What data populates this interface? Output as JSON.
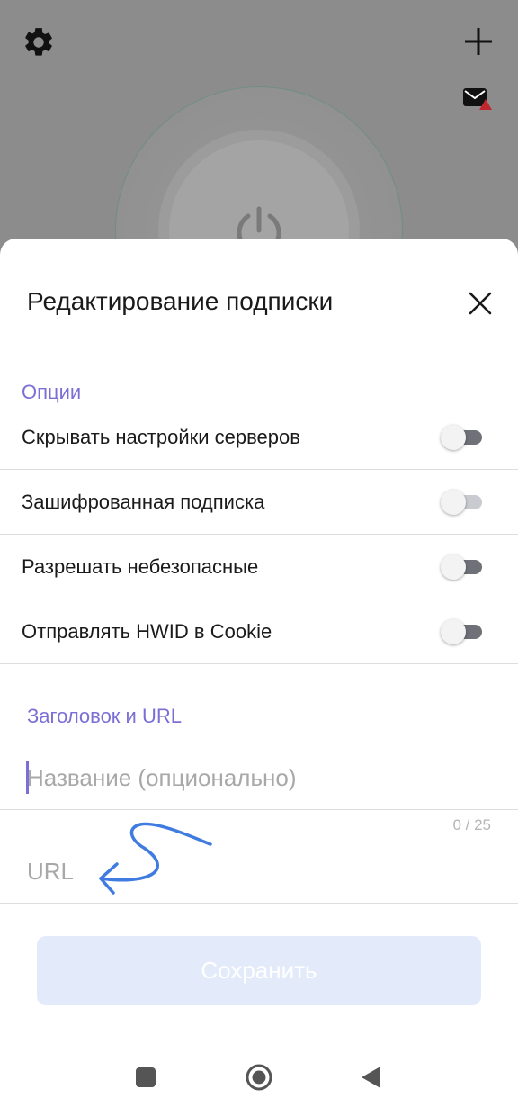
{
  "sheet": {
    "title": "Редактирование подписки"
  },
  "options": {
    "section_label": "Опции",
    "items": [
      {
        "label": "Скрывать настройки серверов",
        "enabled": false
      },
      {
        "label": "Зашифрованная подписка",
        "enabled": false
      },
      {
        "label": "Разрешать небезопасные",
        "enabled": false
      },
      {
        "label": "Отправлять HWID в Cookie",
        "enabled": false
      }
    ]
  },
  "title_url": {
    "section_label": "Заголовок и URL",
    "name_placeholder": "Название (опционально)",
    "name_value": "",
    "counter": "0 / 25",
    "url_placeholder": "URL",
    "url_value": ""
  },
  "save_label": "Сохранить",
  "colors": {
    "accent": "#7b6fd6",
    "save_bg": "#e3ebfb",
    "annotation": "#3f7be0"
  },
  "icons": {
    "settings": "gear-icon",
    "add": "plus-icon",
    "mail": "mail-alert-icon",
    "power": "power-icon",
    "close": "close-icon",
    "nav_recents": "square-icon",
    "nav_home": "circle-icon",
    "nav_back": "triangle-back-icon"
  }
}
